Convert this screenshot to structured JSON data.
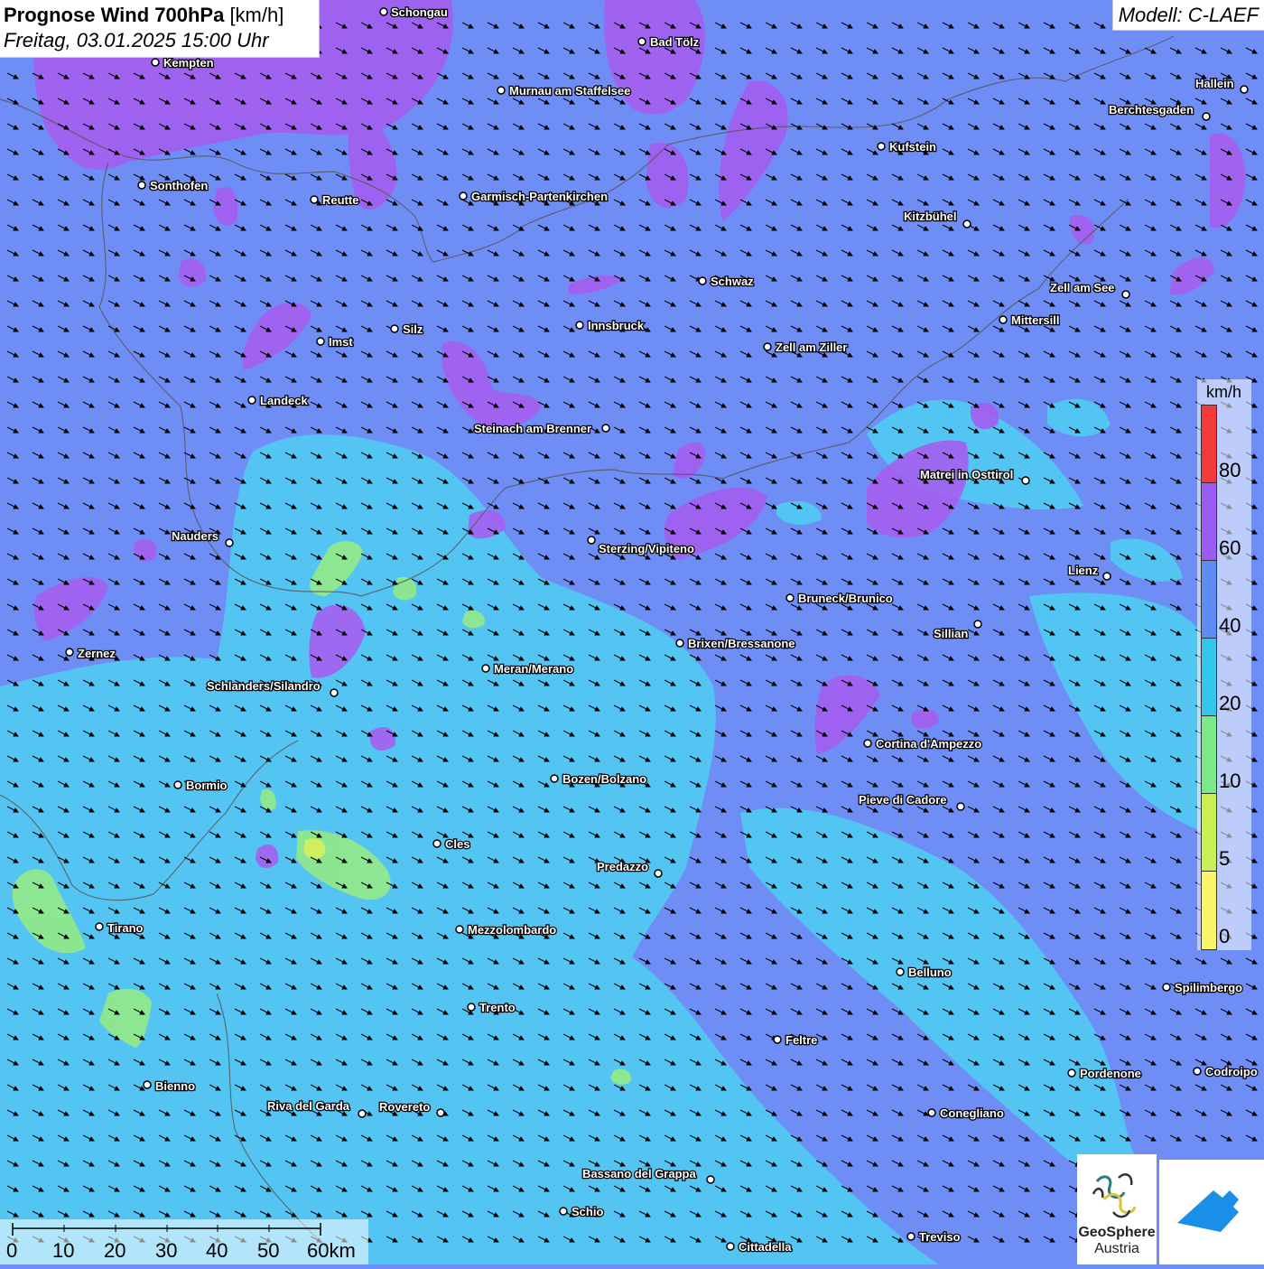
{
  "header": {
    "title_bold": "Prognose Wind 700hPa",
    "title_unit": "[km/h]",
    "datetime": "Freitag, 03.01.2025 15:00 Uhr",
    "model": "Modell: C-LAEF"
  },
  "legend": {
    "unit": "km/h",
    "ticks": [
      "80",
      "60",
      "40",
      "20",
      "10",
      "5",
      "0"
    ],
    "colors": [
      "#f23a3a",
      "#9b5cf3",
      "#5e8cf5",
      "#33c6ef",
      "#7be88a",
      "#c8f052",
      "#fbf56a"
    ]
  },
  "scalebar": {
    "labels": [
      "0",
      "10",
      "20",
      "30",
      "40",
      "50",
      "60km"
    ]
  },
  "logos": {
    "geosphere_line1": "GeoSphere",
    "geosphere_line2": "Austria"
  },
  "cities": [
    {
      "name": "Schongau"
    },
    {
      "name": "Bad Tölz"
    },
    {
      "name": "Kempten"
    },
    {
      "name": "Murnau am Staffelsee"
    },
    {
      "name": "Hallein"
    },
    {
      "name": "Berchtesgaden"
    },
    {
      "name": "Kufstein"
    },
    {
      "name": "Sonthofen"
    },
    {
      "name": "Reutte"
    },
    {
      "name": "Garmisch-Partenkirchen"
    },
    {
      "name": "Kitzbühel"
    },
    {
      "name": "Schwaz"
    },
    {
      "name": "Zell am See"
    },
    {
      "name": "Innsbruck"
    },
    {
      "name": "Mittersill"
    },
    {
      "name": "Silz"
    },
    {
      "name": "Imst"
    },
    {
      "name": "Zell am Ziller"
    },
    {
      "name": "Landeck"
    },
    {
      "name": "Steinach am Brenner"
    },
    {
      "name": "Matrei in Osttirol"
    },
    {
      "name": "Nauders"
    },
    {
      "name": "Sterzing/Vipiteno"
    },
    {
      "name": "Lienz"
    },
    {
      "name": "Bruneck/Brunico"
    },
    {
      "name": "Sillian"
    },
    {
      "name": "Zernez"
    },
    {
      "name": "Brixen/Bressanone"
    },
    {
      "name": "Meran/Merano"
    },
    {
      "name": "Schlanders/Silandro"
    },
    {
      "name": "Cortina d'Ampezzo"
    },
    {
      "name": "Bozen/Bolzano"
    },
    {
      "name": "Bormio"
    },
    {
      "name": "Pieve di Cadore"
    },
    {
      "name": "Cles"
    },
    {
      "name": "Predazzo"
    },
    {
      "name": "Tirano"
    },
    {
      "name": "Mezzolombardo"
    },
    {
      "name": "Belluno"
    },
    {
      "name": "Spilimbergo"
    },
    {
      "name": "Trento"
    },
    {
      "name": "Feltre"
    },
    {
      "name": "Pordenone"
    },
    {
      "name": "Codroipo"
    },
    {
      "name": "Bienno"
    },
    {
      "name": "Riva del Garda"
    },
    {
      "name": "Rovereto"
    },
    {
      "name": "Conegliano"
    },
    {
      "name": "Bassano del Grappa"
    },
    {
      "name": "Schio"
    },
    {
      "name": "Treviso"
    },
    {
      "name": "Cittadella"
    }
  ]
}
